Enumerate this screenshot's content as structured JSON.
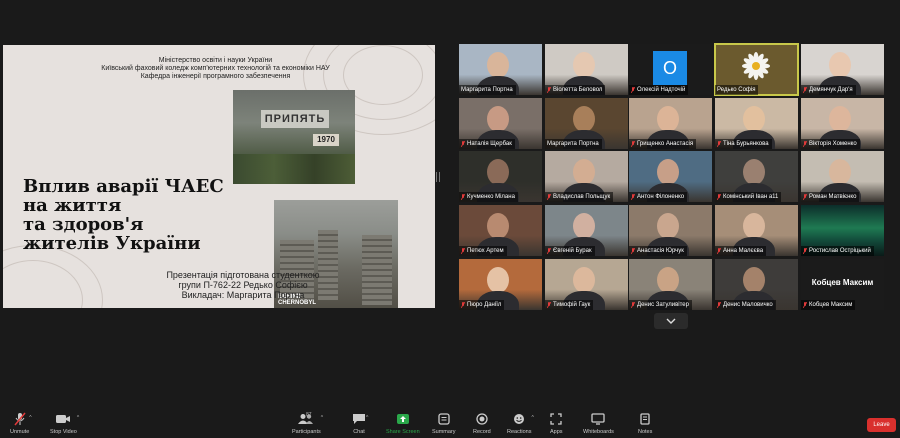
{
  "slide": {
    "header": [
      "Міністерство освіти і науки України",
      "Київський фаховий коледж комп'ютерних технологій та економіки НАУ",
      "Кафедра інженерії програмного забезпечення"
    ],
    "title_lines": [
      "Вплив аварії ЧАЕС",
      "на життя",
      "та здоров'я",
      "жителів України"
    ],
    "footer": [
      "Презентація підготована студенткою",
      "групи П-762-22 Редько Софією",
      "Викладач: Маргарита Портна"
    ],
    "photo1_sign": "ПРИПЯТЬ",
    "photo1_year": "1970",
    "photo2_brand": "BEHIND\nCHERNOBYL"
  },
  "participants": [
    {
      "name": "Маргарита Портна",
      "muted": false,
      "kind": "video",
      "bg": "#a9b6c4",
      "skin": "#d9b59a"
    },
    {
      "name": "Віолетта Беловол",
      "muted": true,
      "kind": "video",
      "bg": "#cfcac4",
      "skin": "#e5c8b1"
    },
    {
      "name": "Олексій Надточій",
      "muted": true,
      "kind": "avatar",
      "avatar_text": "O"
    },
    {
      "name": "Редько Софія",
      "muted": false,
      "kind": "flower",
      "speaking": true
    },
    {
      "name": "Демянчук Дар'я",
      "muted": true,
      "kind": "video",
      "bg": "#d8d4d0",
      "skin": "#e8c8b0"
    },
    {
      "name": "Наталія Щербак",
      "muted": true,
      "kind": "video",
      "bg": "#7a6f68",
      "skin": "#c79a84"
    },
    {
      "name": "Маргарита Портна",
      "muted": false,
      "kind": "video",
      "bg": "#5a4630",
      "skin": "#a87f5a"
    },
    {
      "name": "Грищенко Анастасія",
      "muted": true,
      "kind": "video",
      "bg": "#b9a38f",
      "skin": "#dcb497"
    },
    {
      "name": "Тіна Бурьянкова",
      "muted": true,
      "kind": "video",
      "bg": "#cbb9a4",
      "skin": "#e2c09e"
    },
    {
      "name": "Вікторія Хоменко",
      "muted": true,
      "kind": "video",
      "bg": "#c8b6a6",
      "skin": "#ddb69c"
    },
    {
      "name": "Кучменко Мілана",
      "muted": true,
      "kind": "video",
      "bg": "#2e2f2a",
      "skin": "#8a6a58"
    },
    {
      "name": "Владислав Польщук",
      "muted": true,
      "kind": "video",
      "bg": "#b5aaa0",
      "skin": "#d3ad92"
    },
    {
      "name": "Антон Філоненко",
      "muted": true,
      "kind": "video",
      "bg": "#4f6c83",
      "skin": "#c79f88"
    },
    {
      "name": "Комінський Іван а11",
      "muted": true,
      "kind": "video",
      "bg": "#3f3f3d",
      "skin": "#9a8070"
    },
    {
      "name": "Роман Матвієнко",
      "muted": true,
      "kind": "video",
      "bg": "#c4bdb2",
      "skin": "#d8b79d"
    },
    {
      "name": "Петюх Артем",
      "muted": true,
      "kind": "video",
      "bg": "#6b4a3a",
      "skin": "#b88a70"
    },
    {
      "name": "Євгеній Бурак",
      "muted": true,
      "kind": "video",
      "bg": "#7d868a",
      "skin": "#d1b0a0"
    },
    {
      "name": "Анастасія Юрчук",
      "muted": true,
      "kind": "video",
      "bg": "#8c7a6a",
      "skin": "#c9a68e"
    },
    {
      "name": "Анна Малєєва",
      "muted": true,
      "kind": "video",
      "bg": "#a68e78",
      "skin": "#d8b69c"
    },
    {
      "name": "Ростислав Остріцький",
      "muted": true,
      "kind": "aurora"
    },
    {
      "name": "Пюро Даніїл",
      "muted": true,
      "kind": "video",
      "bg": "#b46a3c",
      "skin": "#e5c2a5"
    },
    {
      "name": "Тимофій Гаук",
      "muted": true,
      "kind": "video",
      "bg": "#b6a793",
      "skin": "#dcb89c"
    },
    {
      "name": "Денис Затуливітер",
      "muted": true,
      "kind": "video",
      "bg": "#8a8378",
      "skin": "#c9a385"
    },
    {
      "name": "Денис Маловичко",
      "muted": true,
      "kind": "video",
      "bg": "#3e3c3a",
      "skin": "#a4826a"
    },
    {
      "name": "Кобцев Максим",
      "muted": true,
      "kind": "text",
      "big_name": "Кобцев Максим"
    }
  ],
  "toolbar": {
    "unmute": "Unmute",
    "stop_video": "Stop Video",
    "participants": "Participants",
    "participants_count": "87",
    "chat": "Chat",
    "share_screen": "Share Screen",
    "summary": "Summary",
    "record": "Record",
    "reactions": "Reactions",
    "apps": "Apps",
    "whiteboards": "Whiteboards",
    "notes": "Notes",
    "leave": "Leave"
  },
  "colors": {
    "share_green": "#2aa84a",
    "leave_red": "#d9302d",
    "speaking_outline": "#c8c84a",
    "avatar_blue": "#1a8ae5",
    "muted_red": "#e23a3a"
  }
}
